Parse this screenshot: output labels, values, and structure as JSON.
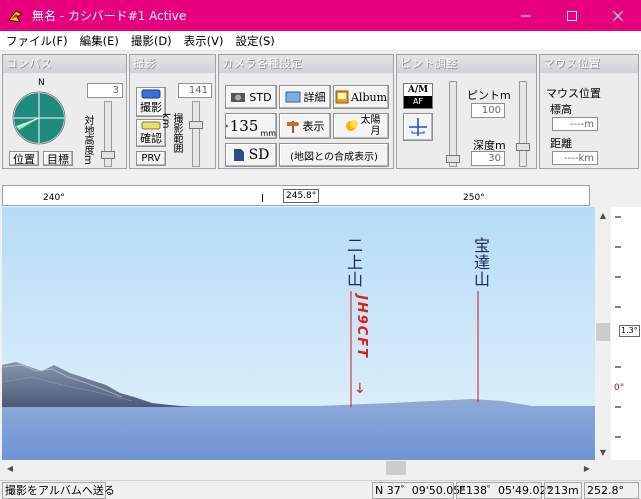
{
  "window": {
    "title": "無名 - カシバード#1 Active"
  },
  "menu": [
    "ファイル(F)",
    "編集(E)",
    "撮影(D)",
    "表示(V)",
    "設定(S)"
  ],
  "panels": {
    "compass": {
      "header": "コンパス",
      "north": "N",
      "height_value": "3",
      "height_label": "対地高度m",
      "btn_position": "位置",
      "btn_target": "目標"
    },
    "shoot": {
      "header": "撮影",
      "range_value": "141",
      "btn_shoot": "撮影",
      "btn_confirm": "確認",
      "btn_prv": "PRV",
      "range_label": "撮影範囲km"
    },
    "camera": {
      "header": "カメラ各種設定",
      "btn_std": "STD",
      "btn_detail": "詳細",
      "btn_album": "Album",
      "btn_135": "135",
      "btn_135_unit": "mm",
      "btn_display": "表示",
      "btn_sun_line1": "太陽",
      "btn_sun_line2": "月",
      "btn_sd": "SD",
      "btn_composite": "(地図との合成表示)"
    },
    "focus": {
      "header": "ピント調整",
      "am_label": "A/M",
      "af_label": "AF",
      "focus_label": "ピントm",
      "focus_value": "100",
      "depth_label": "深度m",
      "depth_value": "30"
    },
    "mouse": {
      "header": "マウス位置",
      "title": "マウス位置",
      "elev_label": "標高",
      "elev_value": "----m",
      "dist_label": "距離",
      "dist_value": "----km"
    }
  },
  "ruler": {
    "left_tick": "240°",
    "center_value": "245.8°",
    "right_tick": "250°"
  },
  "elevation_ruler": {
    "value": "1.3°",
    "zero": "0°"
  },
  "scene": {
    "peak1": "二上山",
    "peak2": "宝達山",
    "callsign": "JH9CFT",
    "arrow": "↓"
  },
  "statusbar": {
    "send_album": "撮影をアルバムへ送る",
    "lat": "N 37゜09'50.05\"",
    "lon": "E138゜05'49.02\"",
    "alt": "213m",
    "bearing": "252.8°"
  },
  "colors": {
    "titlebar": "#e6007e",
    "callsign": "#e01919"
  }
}
